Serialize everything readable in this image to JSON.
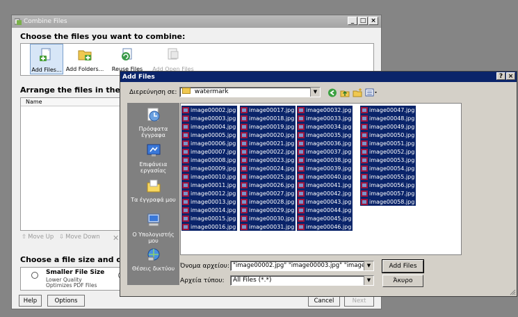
{
  "combine_window": {
    "title": "Combine Files",
    "heading_choose": "Choose the files you want to combine:",
    "toolbar": [
      {
        "label": "Add Files...",
        "icon": "add-files-icon",
        "state": "selected"
      },
      {
        "label": "Add Folders...",
        "icon": "add-folder-icon",
        "state": "normal"
      },
      {
        "label": "Reuse Files",
        "icon": "reuse-files-icon",
        "state": "normal"
      },
      {
        "label": "Add Open Files",
        "icon": "add-open-files-icon",
        "state": "disabled"
      }
    ],
    "heading_arrange": "Arrange the files in the order",
    "list_column": "Name",
    "move_up": "Move Up",
    "move_down": "Move Down",
    "heading_size": "Choose a file size and conve",
    "option_smaller": {
      "title": "Smaller File Size",
      "line1": "Lower Quality",
      "line2": "Optimizes PDF Files"
    },
    "help_label": "Help",
    "options_label": "Options",
    "cancel_label": "Cancel",
    "next_label": "Next"
  },
  "add_files_dialog": {
    "title": "Add Files",
    "look_in_label": "Διερεύνηση σε:",
    "look_in_value": "watermark",
    "places": [
      {
        "label": "Πρόσφατα έγγραφα",
        "icon": "recent-documents-icon"
      },
      {
        "label": "Επιφάνεια εργασίας",
        "icon": "desktop-icon"
      },
      {
        "label": "Τα έγγραφά μου",
        "icon": "my-documents-icon"
      },
      {
        "label": "Ο Υπολογιστής μου",
        "icon": "my-computer-icon"
      },
      {
        "label": "Θέσεις δικτύου",
        "icon": "network-places-icon"
      }
    ],
    "columns": [
      [
        "image00002.jpg",
        "image00003.jpg",
        "image00004.jpg",
        "image00005.jpg",
        "image00006.jpg",
        "image00007.jpg",
        "image00008.jpg",
        "image00009.jpg",
        "image00010.jpg",
        "image00011.jpg",
        "image00012.jpg",
        "image00013.jpg",
        "image00014.jpg",
        "image00015.jpg",
        "image00016.jpg"
      ],
      [
        "image00017.jpg",
        "image00018.jpg",
        "image00019.jpg",
        "image00020.jpg",
        "image00021.jpg",
        "image00022.jpg",
        "image00023.jpg",
        "image00024.jpg",
        "image00025.jpg",
        "image00026.jpg",
        "image00027.jpg",
        "image00028.jpg",
        "image00029.jpg",
        "image00030.jpg",
        "image00031.jpg"
      ],
      [
        "image00032.jpg",
        "image00033.jpg",
        "image00034.jpg",
        "image00035.jpg",
        "image00036.jpg",
        "image00037.jpg",
        "image00038.jpg",
        "image00039.jpg",
        "image00040.jpg",
        "image00041.jpg",
        "image00042.jpg",
        "image00043.jpg",
        "image00044.jpg",
        "image00045.jpg",
        "image00046.jpg"
      ],
      [
        "image00047.jpg",
        "image00048.jpg",
        "image00049.jpg",
        "image00050.jpg",
        "image00051.jpg",
        "image00052.jpg",
        "image00053.jpg",
        "image00054.jpg",
        "image00055.jpg",
        "image00056.jpg",
        "image00057.jpg",
        "image00058.jpg"
      ]
    ],
    "filename_label": "Όνομα αρχείου:",
    "filename_value": "\"image00002.jpg\" \"image00003.jpg\" \"image00004.jp",
    "filetype_label": "Αρχεία τύπου:",
    "filetype_value": "All Files (*.*)",
    "add_button": "Add Files",
    "cancel_button": "Άκυρο",
    "selection_color": "#0a246a"
  }
}
